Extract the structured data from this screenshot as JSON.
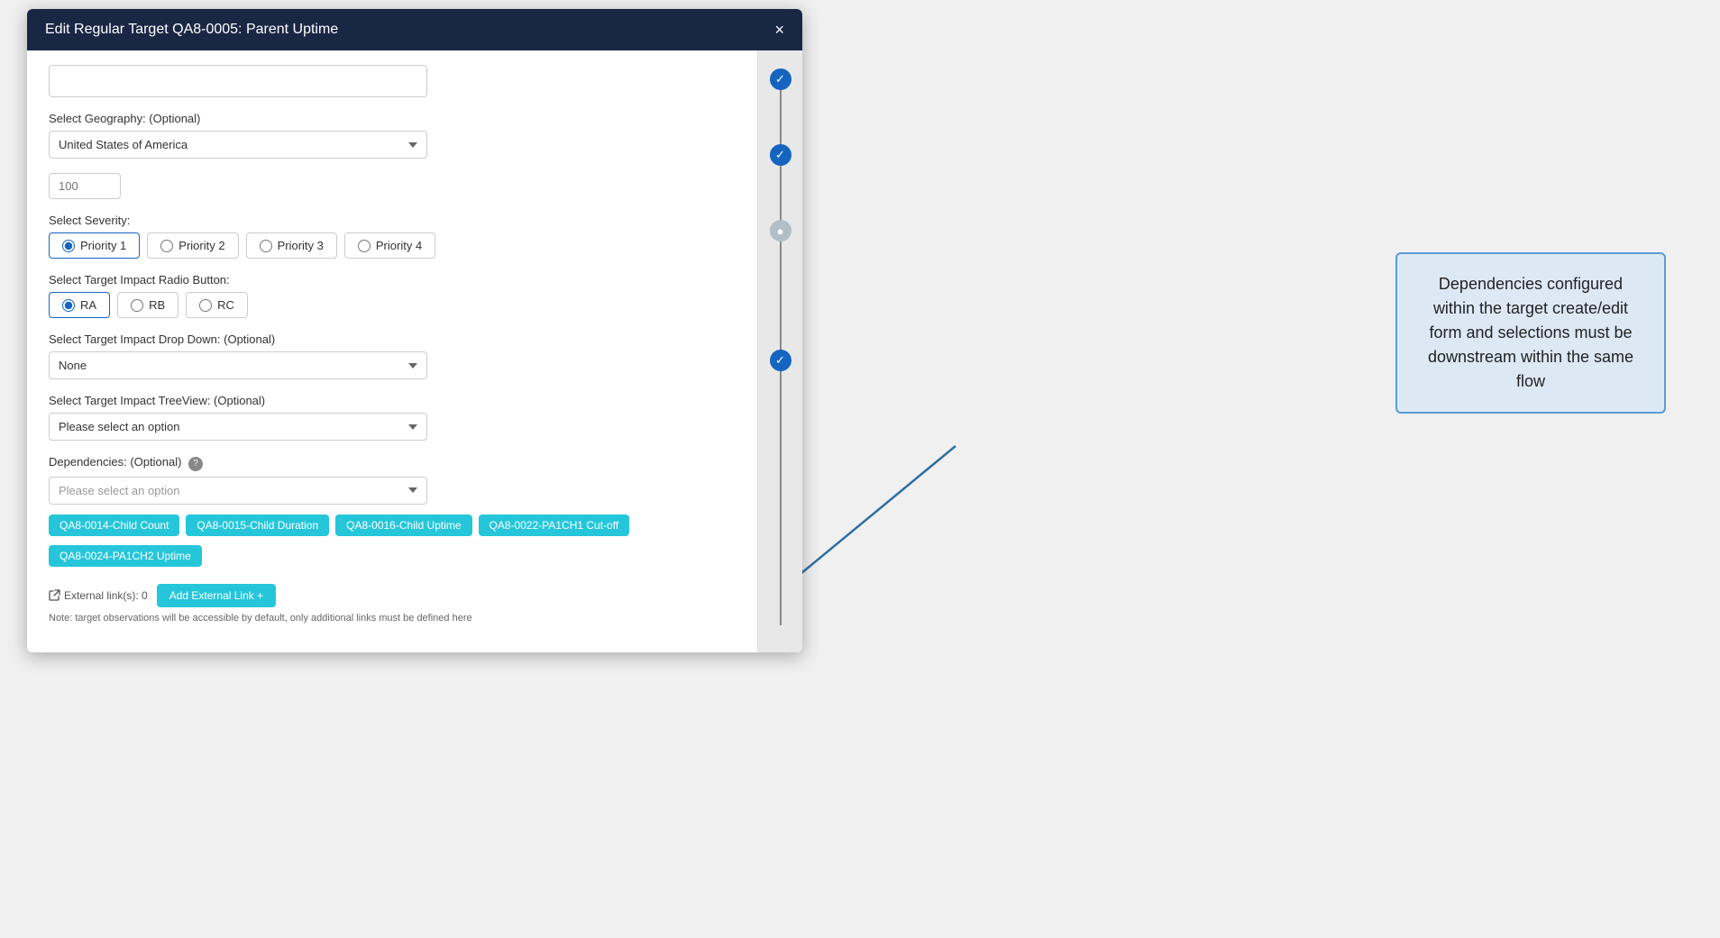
{
  "modal": {
    "title": "Edit Regular Target QA8-0005: Parent Uptime",
    "close_label": "×"
  },
  "form": {
    "geography_label": "Select Geography: (Optional)",
    "geography_value": "United States of America",
    "geography_number_placeholder": "100",
    "severity_label": "Select Severity:",
    "severity_options": [
      {
        "id": "p1",
        "label": "Priority 1",
        "selected": true
      },
      {
        "id": "p2",
        "label": "Priority 2",
        "selected": false
      },
      {
        "id": "p3",
        "label": "Priority 3",
        "selected": false
      },
      {
        "id": "p4",
        "label": "Priority 4",
        "selected": false
      }
    ],
    "impact_radio_label": "Select Target Impact Radio Button:",
    "impact_radio_options": [
      {
        "id": "ra",
        "label": "RA",
        "selected": true
      },
      {
        "id": "rb",
        "label": "RB",
        "selected": false
      },
      {
        "id": "rc",
        "label": "RC",
        "selected": false
      }
    ],
    "impact_dropdown_label": "Select Target Impact Drop Down: (Optional)",
    "impact_dropdown_value": "None",
    "impact_treeview_label": "Select Target Impact TreeView: (Optional)",
    "impact_treeview_placeholder": "Please select an option",
    "dependencies_label": "Dependencies: (Optional)",
    "dependencies_placeholder": "Please select an option",
    "dependency_tags": [
      "QA8-0014-Child Count",
      "QA8-0015-Child Duration",
      "QA8-0016-Child Uptime",
      "QA8-0022-PA1CH1 Cut-off",
      "QA8-0024-PA1CH2 Uptime"
    ],
    "external_links_label": "External link(s): 0",
    "add_external_link_label": "Add External Link  +",
    "note_text": "Note: target observations will be accessible by default, only additional links must be defined here"
  },
  "sidebar": {
    "dots": [
      {
        "type": "completed",
        "icon": "✓"
      },
      {
        "type": "completed",
        "icon": "✓"
      },
      {
        "type": "active",
        "icon": "●"
      },
      {
        "type": "completed",
        "icon": "✓"
      }
    ]
  },
  "callout": {
    "text": "Dependencies configured within the target create/edit form and selections must be downstream within the same flow"
  }
}
